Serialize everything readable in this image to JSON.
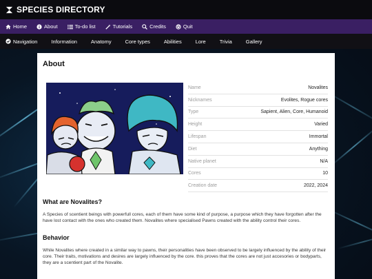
{
  "site": {
    "title": "SPECIES DIRECTORY"
  },
  "main_nav": [
    {
      "label": "Home",
      "icon": "home-icon"
    },
    {
      "label": "About",
      "icon": "info-icon"
    },
    {
      "label": "To-do list",
      "icon": "list-icon"
    },
    {
      "label": "Tutorials",
      "icon": "wand-icon"
    },
    {
      "label": "Credits",
      "icon": "search-icon"
    },
    {
      "label": "Quit",
      "icon": "power-icon"
    }
  ],
  "sub_nav": [
    {
      "label": "Navigation",
      "icon": "check-icon"
    },
    {
      "label": "Information"
    },
    {
      "label": "Anatomy"
    },
    {
      "label": "Core types"
    },
    {
      "label": "Abilities"
    },
    {
      "label": "Lore"
    },
    {
      "label": "Trivia"
    },
    {
      "label": "Gallery"
    }
  ],
  "about": {
    "title": "About",
    "info": [
      {
        "key": "Name",
        "value": "Novalites"
      },
      {
        "key": "Nicknames",
        "value": "Evolites, Rogue cores"
      },
      {
        "key": "Type",
        "value": "Sapient, Alien, Core, Humanoid"
      },
      {
        "key": "Height",
        "value": "Varied"
      },
      {
        "key": "Lifespan",
        "value": "Immortal"
      },
      {
        "key": "Diet",
        "value": "Anything"
      },
      {
        "key": "Native planet",
        "value": "N/A"
      },
      {
        "key": "Cores",
        "value": "10"
      },
      {
        "key": "Creation date",
        "value": "2022, 2024"
      }
    ],
    "what_title": "What are Novalites?",
    "what_text": "A Species of scentient beings with powerfull cores, each of them have some kind of purpose, a purpose which they have forgotten after the have lost contact with the ones who created them. Novalites where specialised Pawns created with the ability control their cores.",
    "behavior_title": "Behavior",
    "behavior_text": "While Novalites where created in a similar way to pawns, their personalities have been observed to be largely influenced by the ability of their core. Their traits, motivations and desires are largely influenced by the core. this proves that the cores are not just accesories or bodyparts, they are a scentient part of the Novalite."
  },
  "colors": {
    "top_bar": "#0b0b0f",
    "main_nav": "#3a1f63",
    "sub_nav": "#111015",
    "background": "#07101c"
  }
}
